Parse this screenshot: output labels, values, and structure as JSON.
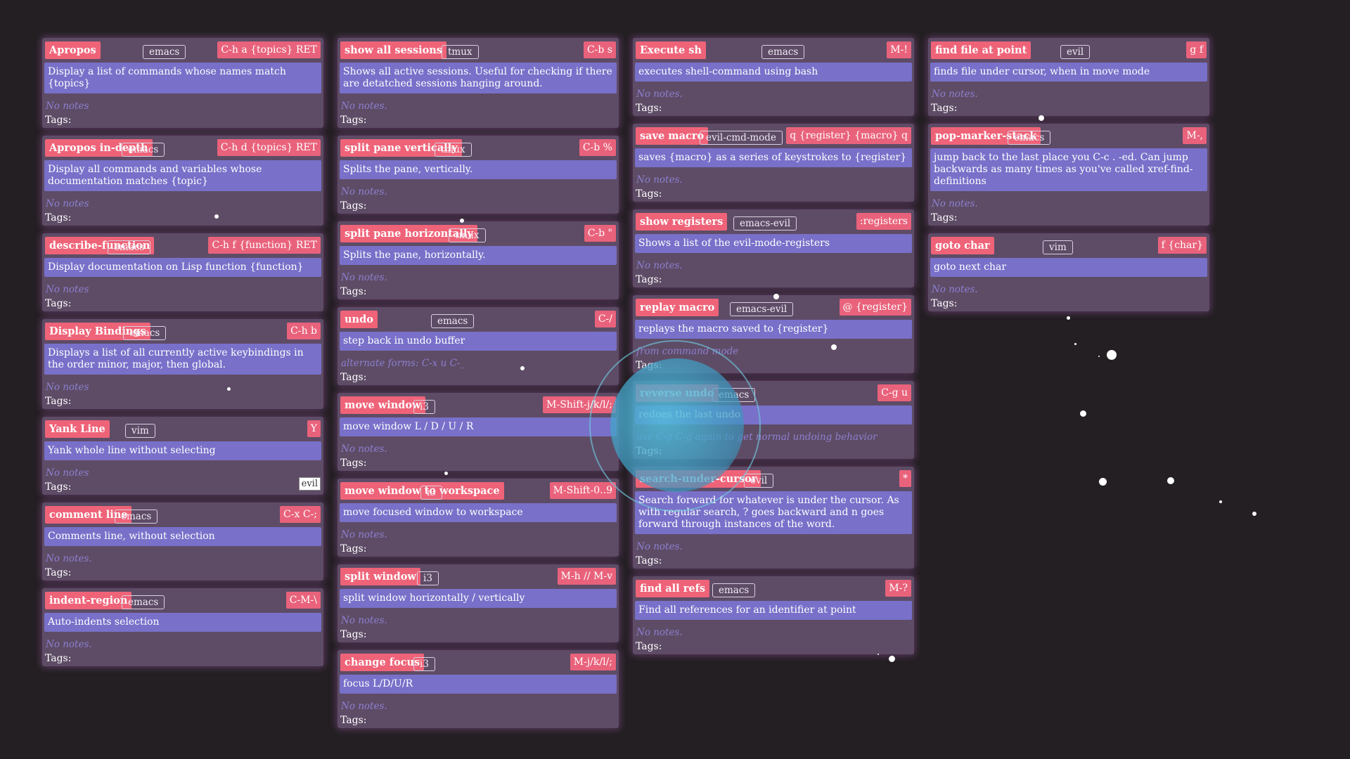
{
  "columns": [
    [
      {
        "title": "Apropos",
        "app": "emacs",
        "keys": "C-h a {topics} RET",
        "desc": "Display a list of commands whose names match {topics}",
        "notes": "No notes",
        "tags_label": "Tags:"
      },
      {
        "title": "Apropos in-depth",
        "app": "emacs",
        "keys": "C-h d {topics} RET",
        "desc": "Display all commands and variables whose documentation matches {topic}",
        "notes": "No notes",
        "tags_label": "Tags:"
      },
      {
        "title": "describe-function",
        "app": "emacs",
        "keys": "C-h f {function} RET",
        "desc": "Display documentation on Lisp function {function}",
        "notes": "No notes",
        "tags_label": "Tags:"
      },
      {
        "title": "Display Bindings",
        "app": "emacs",
        "keys": "C-h b",
        "desc": "Displays a list of all currently active keybindings in the order minor, major, then global.",
        "notes": "No notes",
        "tags_label": "Tags:"
      },
      {
        "title": "Yank Line",
        "app": "vim",
        "keys": "Y",
        "desc": "Yank whole line without selecting",
        "notes": "No notes",
        "tags_label": "Tags:",
        "tag_chip": "evil"
      },
      {
        "title": "comment line",
        "app": "emacs",
        "keys": "C-x C-;",
        "desc": "Comments line, without selection",
        "notes": "No notes.",
        "tags_label": "Tags:"
      },
      {
        "title": "indent-region",
        "app": "emacs",
        "keys": "C-M-\\",
        "desc": "Auto-indents selection",
        "notes": "No notes.",
        "tags_label": "Tags:"
      }
    ],
    [
      {
        "title": "show all sessions",
        "app": "tmux",
        "keys": "C-b s",
        "desc": "Shows all active sessions. Useful for checking if there are detatched sessions hanging around.",
        "notes": "No notes.",
        "tags_label": "Tags:"
      },
      {
        "title": "split pane vertically",
        "app": "tmux",
        "keys": "C-b %",
        "desc": "Splits the pane, vertically.",
        "notes": "No notes.",
        "tags_label": "Tags:"
      },
      {
        "title": "split pane horizontally",
        "app": "tmux",
        "keys": "C-b \"",
        "desc": "Splits the pane, horizontally.",
        "notes": "No notes.",
        "tags_label": "Tags:"
      },
      {
        "title": "undo",
        "app": "emacs",
        "keys": "C-/",
        "desc": "step back in undo buffer",
        "notes": "alternate forms: C-x u C-_",
        "tags_label": "Tags:"
      },
      {
        "title": "move window",
        "app": "i3",
        "keys": "M-Shift-j/k/l/;",
        "desc": "move window L / D / U / R",
        "notes": "No notes.",
        "tags_label": "Tags:"
      },
      {
        "title": "move window to workspace",
        "app": "i3",
        "keys": "M-Shift-0..9",
        "desc": "move focused window to workspace",
        "notes": "No notes.",
        "tags_label": "Tags:"
      },
      {
        "title": "split window",
        "app": "i3",
        "keys": "M-h // M-v",
        "desc": "split window horizontally / vertically",
        "notes": "No notes.",
        "tags_label": "Tags:"
      },
      {
        "title": "change focus",
        "app": "i3",
        "keys": "M-j/k/l/;",
        "desc": "focus L/D/U/R",
        "notes": "No notes.",
        "tags_label": "Tags:"
      }
    ],
    [
      {
        "title": "Execute sh",
        "app": "emacs",
        "keys": "M-!",
        "desc": "executes shell-command using bash",
        "notes": "No notes.",
        "tags_label": "Tags:"
      },
      {
        "title": "save macro",
        "app": "evil-cmd-mode",
        "keys": "q {register} {macro} q",
        "desc": "saves {macro} as a series of keystrokes to {register}",
        "notes": "No notes.",
        "tags_label": "Tags:"
      },
      {
        "title": "show registers",
        "app": "emacs-evil",
        "keys": ":registers",
        "desc": "Shows a list of the evil-mode-registers",
        "notes": "No notes.",
        "tags_label": "Tags:"
      },
      {
        "title": "replay macro",
        "app": "emacs-evil",
        "keys": "@ {register}",
        "desc": "replays the macro saved to {register}",
        "notes": "from command mode",
        "tags_label": "Tags:"
      },
      {
        "title": "reverse undo",
        "app": "emacs",
        "keys": "C-g u",
        "desc": "redoes the last undo",
        "notes": "use C-g C-g again to get normal undoing behavior",
        "tags_label": "Tags:"
      },
      {
        "title": "search-under-cursor",
        "app": "evil",
        "keys": "*",
        "desc": "Search forward for whatever is under the cursor. As with regular search, ? goes backward and n goes forward through instances of the word.",
        "notes": "No notes.",
        "tags_label": "Tags:"
      },
      {
        "title": "find all refs",
        "app": "emacs",
        "keys": "M-?",
        "desc": "Find all references for an identifier at point",
        "notes": "No notes.",
        "tags_label": "Tags:"
      }
    ],
    [
      {
        "title": "find file at point",
        "app": "evil",
        "keys": "g f",
        "desc": "finds file under cursor, when in move mode",
        "notes": "No notes.",
        "tags_label": "Tags:"
      },
      {
        "title": "pop-marker-stack",
        "app": "emacs",
        "keys": "M-,",
        "desc": "jump back to the last place you C-c . -ed. Can jump backwards as many times as you've called xref-find-definitions",
        "notes": "No notes.",
        "tags_label": "Tags:"
      },
      {
        "title": "goto char",
        "app": "vim",
        "keys": "f {char}",
        "desc": "goto next char",
        "notes": "No notes.",
        "tags_label": "Tags:"
      }
    ]
  ]
}
